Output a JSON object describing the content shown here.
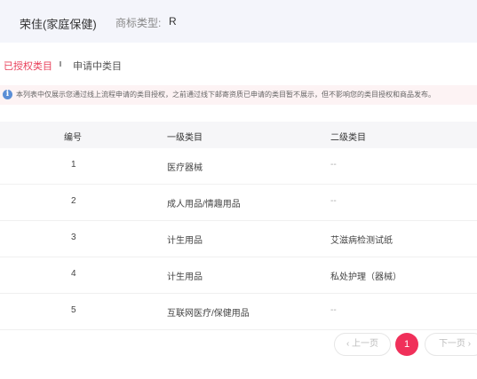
{
  "header": {
    "brand": "荣佳(家庭保健)",
    "type_label": "商标类型:",
    "type_value": "R"
  },
  "tabs": [
    {
      "label": "已授权类目",
      "active": true
    },
    {
      "label": "申请中类目",
      "active": false
    }
  ],
  "notice": {
    "icon": "info-icon",
    "text": "本列表中仅展示您通过线上流程申请的类目授权，之前通过线下邮寄资质已申请的类目暂不展示，但不影响您的类目授权和商品发布。"
  },
  "table": {
    "headers": [
      "编号",
      "一级类目",
      "二级类目"
    ],
    "rows": [
      {
        "no": "1",
        "level1": "医疗器械",
        "level2": "--"
      },
      {
        "no": "2",
        "level1": "成人用品/情趣用品",
        "level2": "--"
      },
      {
        "no": "3",
        "level1": "计生用品",
        "level2": "艾滋病检测试纸"
      },
      {
        "no": "4",
        "level1": "计生用品",
        "level2": "私处护理（器械）"
      },
      {
        "no": "5",
        "level1": "互联网医疗/保健用品",
        "level2": "--"
      }
    ]
  },
  "pager": {
    "prev": "‹ 上一页",
    "current": "1",
    "next": "下一页 ›"
  },
  "colors": {
    "accent": "#f0305a",
    "header_bg": "#f4f5fb",
    "notice_bg": "#fdf3f4",
    "info_icon": "#5b8ed6"
  }
}
